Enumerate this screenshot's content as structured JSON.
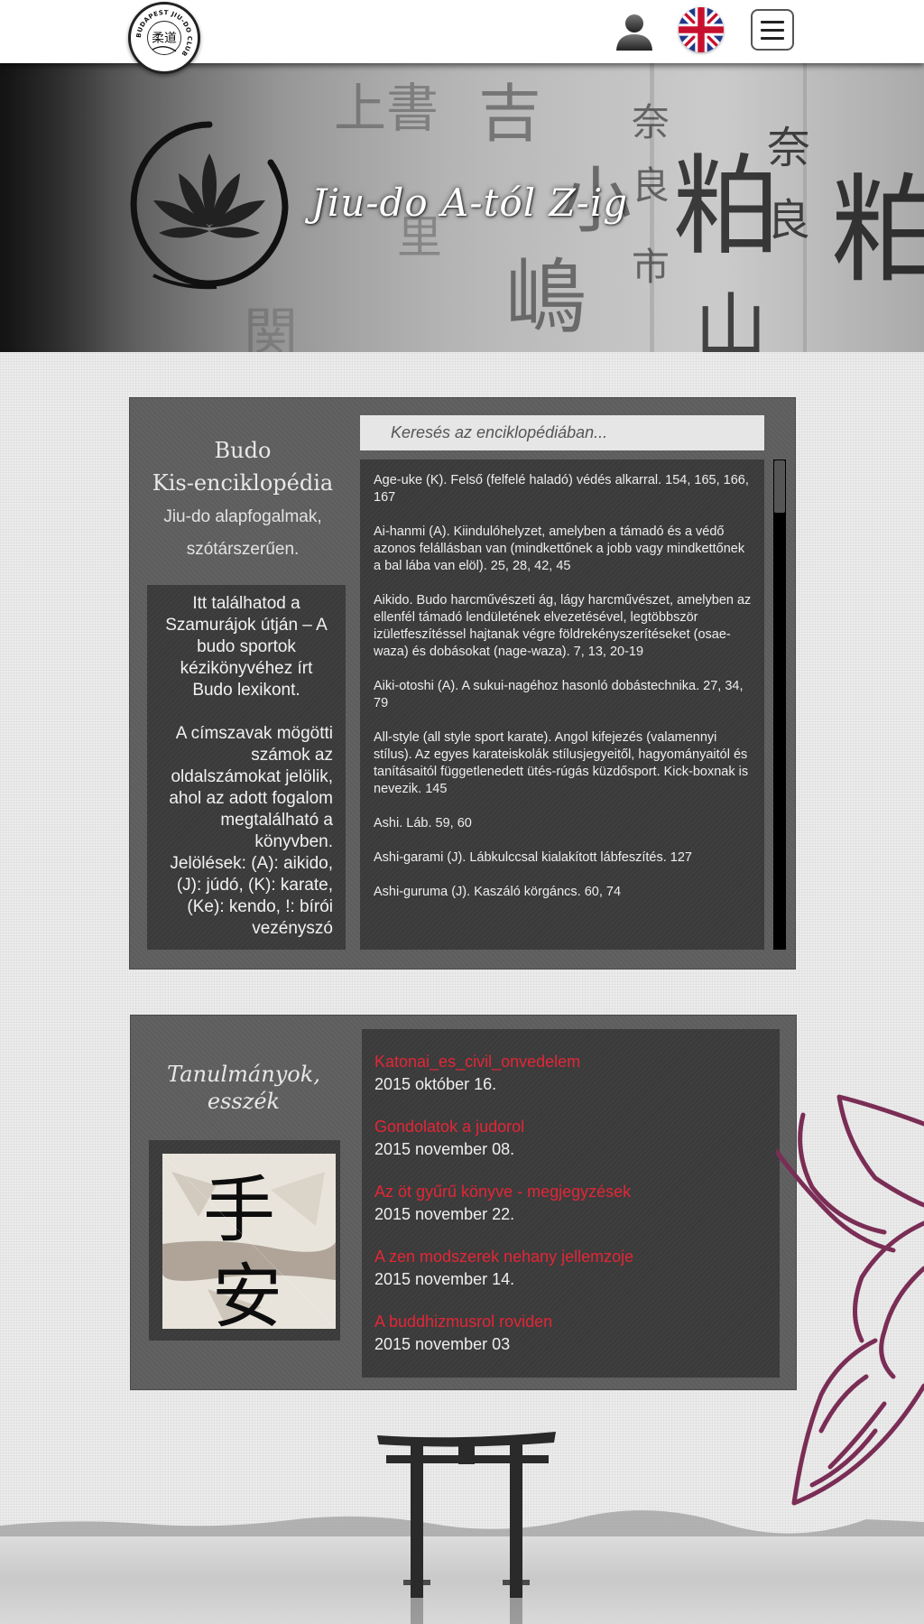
{
  "header": {
    "logo_label": "Budapest Jiu-do Club logo",
    "logo_text": "BUDAPEST JIU-DO CLUB",
    "user_icon": "user-icon",
    "language_icon": "uk-flag-icon",
    "menu_icon": "hamburger-menu-icon"
  },
  "hero": {
    "title": "Jiu-do A-tól Z-ig"
  },
  "encyclopedia": {
    "title_line1": "Budo",
    "title_line2": "Kis-enciklopédia",
    "subtitle_line1": "Jiu-do alapfogalmak,",
    "subtitle_line2": "szótárszerűen.",
    "info_p1": "Itt találhatod a Szamurájok útján – A budo sportok kézikönyvéhez írt Budo lexikont.",
    "info_p2": "A címszavak mögötti számok az oldalszámokat jelölik, ahol az adott fogalom megtalálható a könyvben.",
    "info_p3": "Jelölések: (A): aikido, (J):  júdó, (K): karate, (Ke): kendo, !: bírói vezényszó",
    "search_placeholder": "Keresés az enciklopédiában...",
    "entries": [
      "Age-uke (K). Felső (felfelé haladó) védés alkarral. 154, 165, 166, 167",
      "Ai-hanmi (A). Kiindulóhelyzet, amelyben a támadó és a védő azonos felállásban van (mindkettőnek a jobb vagy mindkettőnek a bal lába van elöl). 25, 28, 42, 45",
      "Aikido. Budo harcművészeti ág, lágy harcművészet, amelyben az ellenfél támadó lendületének elvezetésével, legtöbbször izületfeszítéssel hajtanak végre földrekényszerítéseket (osae-waza) és dobásokat (nage-waza). 7, 13, 20-19",
      "Aiki-otoshi (A). A sukui-nagéhoz hasonló dobástechnika. 27, 34, 79",
      "All-style (all style sport karate). Angol kifejezés (valamennyi stílus). Az egyes karateiskolák stílusjegyeitől, hagyományaitól és tanításaitól függetlenedett ütés-rúgás küzdősport. Kick-boxnak is nevezik. 145",
      "Ashi. Láb. 59, 60",
      "Ashi-garami (J). Lábkulccsal kialakított lábfeszítés. 127",
      "Ashi-guruma (J). Kaszáló körgáncs. 60, 74"
    ]
  },
  "studies": {
    "title_line1": "Tanulmányok,",
    "title_line2": "esszék",
    "image_label": "calligraphy-image",
    "items": [
      {
        "title": "Katonai_es_civil_onvedelem",
        "date": "2015 október 16."
      },
      {
        "title": "Gondolatok a judorol",
        "date": "2015 november 08."
      },
      {
        "title": "Az öt gyűrű könyve - megjegyzések",
        "date": "2015 november 22."
      },
      {
        "title": "A zen modszerek nehany jellemzoje",
        "date": "2015 november 14."
      },
      {
        "title": "A buddhizmusrol roviden",
        "date": "2015 november 03"
      }
    ]
  },
  "colors": {
    "link": "#e32636",
    "panel": "#5d5d5d",
    "dark_box": "#3a3a3a",
    "lotus": "#7a2d55"
  }
}
